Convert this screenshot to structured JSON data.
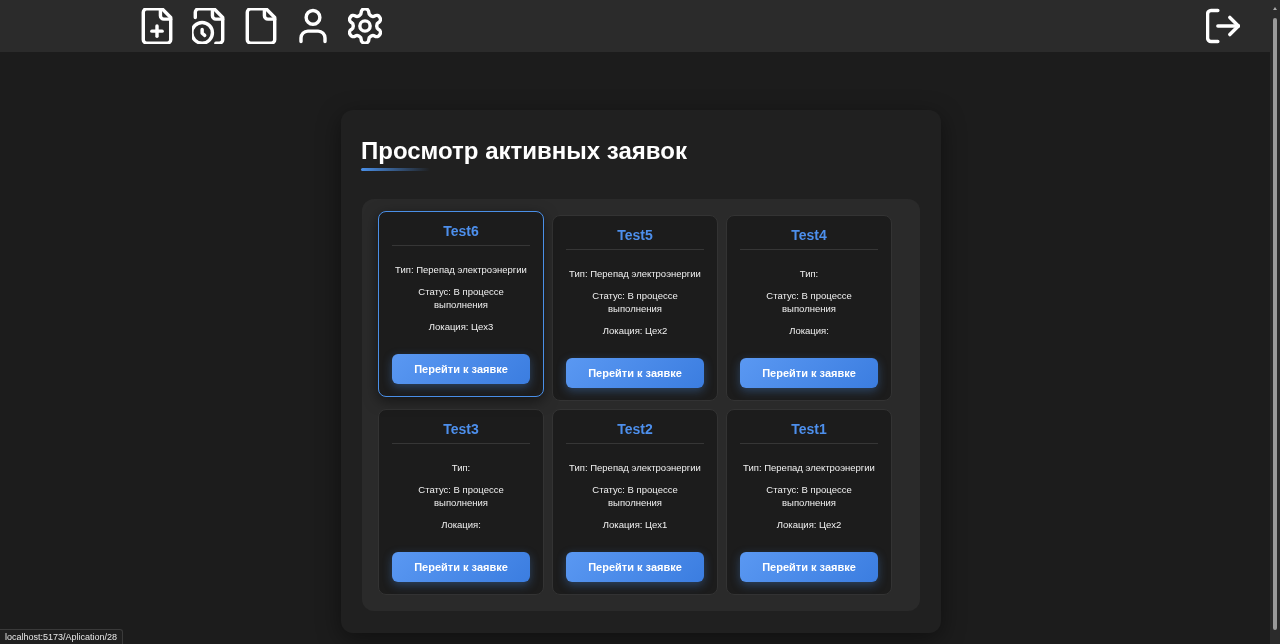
{
  "panel": {
    "title": "Просмотр активных заявок"
  },
  "requests": [
    {
      "title": "Test6",
      "selected": true,
      "type": "Тип: Перепад электроэнергии",
      "status": "Статус: В процессе выполнения",
      "location": "Локация: Цех3",
      "button": "Перейти к заявке"
    },
    {
      "title": "Test5",
      "selected": false,
      "type": "Тип: Перепад электроэнергии",
      "status": "Статус: В процессе выполнения",
      "location": "Локация: Цех2",
      "button": "Перейти к заявке"
    },
    {
      "title": "Test4",
      "selected": false,
      "type": "Тип:",
      "status": "Статус: В процессе выполнения",
      "location": "Локация:",
      "button": "Перейти к заявке"
    },
    {
      "title": "Test3",
      "selected": false,
      "type": "Тип:",
      "status": "Статус: В процессе выполнения",
      "location": "Локация:",
      "button": "Перейти к заявке"
    },
    {
      "title": "Test2",
      "selected": false,
      "type": "Тип: Перепад электроэнергии",
      "status": "Статус: В процессе выполнения",
      "location": "Локация: Цех1",
      "button": "Перейти к заявке"
    },
    {
      "title": "Test1",
      "selected": false,
      "type": "Тип: Перепад электроэнергии",
      "status": "Статус: В процессе выполнения",
      "location": "Локация: Цех2",
      "button": "Перейти к заявке"
    }
  ],
  "status_url": "localhost:5173/Aplication/28"
}
